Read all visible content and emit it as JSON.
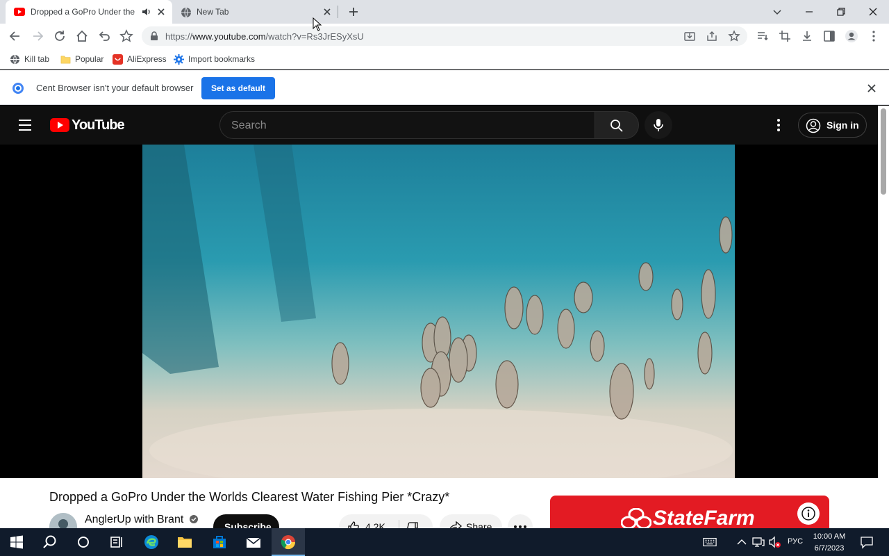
{
  "browser": {
    "tabs": [
      {
        "title": "Dropped a GoPro Under the",
        "active": true,
        "favicon": "youtube-icon",
        "audio": "speaker-icon"
      },
      {
        "title": "New Tab",
        "active": false,
        "favicon": "globe-icon"
      }
    ],
    "url_prefix": "https://",
    "url_host": "www.youtube.com",
    "url_path": "/watch?v=Rs3JrESyXsU",
    "bookmarks": [
      {
        "label": "Kill tab",
        "icon": "globe-icon"
      },
      {
        "label": "Popular",
        "icon": "folder-icon"
      },
      {
        "label": "AliExpress",
        "icon": "aliexpress-icon"
      },
      {
        "label": "Import bookmarks",
        "icon": "gear-icon"
      }
    ],
    "infobar": {
      "text": "Cent Browser isn't your default browser",
      "button": "Set as default"
    }
  },
  "youtube": {
    "logo_text": "YouTube",
    "search_placeholder": "Search",
    "sign_in": "Sign in",
    "video_title": "Dropped a GoPro Under the Worlds Clearest Water Fishing Pier *Crazy*",
    "channel_name": "AnglerUp with Brant",
    "subscribe": "Subscribe",
    "likes": "4.2K",
    "share": "Share",
    "ad_brand": "StateFarm"
  },
  "taskbar": {
    "language": "РУС",
    "time": "10:00 AM",
    "date": "6/7/2023"
  },
  "colors": {
    "youtube_red": "#ff0000",
    "accent_blue": "#1a73e8",
    "ad_red": "#e31b23",
    "taskbar": "#101b2b"
  }
}
